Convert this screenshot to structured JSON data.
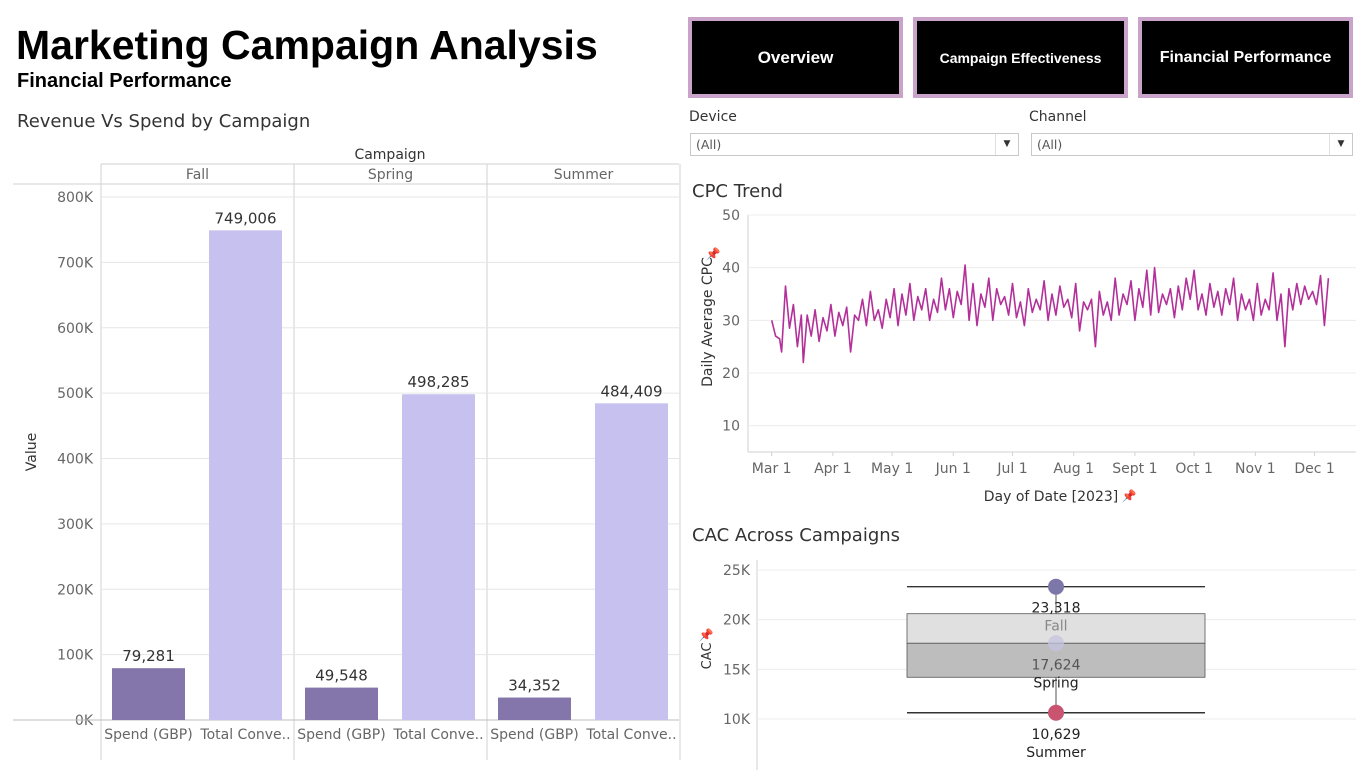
{
  "header": {
    "title": "Marketing Campaign Analysis",
    "subtitle": "Financial Performance"
  },
  "nav": [
    {
      "label": "Overview"
    },
    {
      "label": "Campaign Effectiveness"
    },
    {
      "label": "Financial Performance"
    }
  ],
  "filters": {
    "device": {
      "label": "Device",
      "value": "(All)"
    },
    "channel": {
      "label": "Channel",
      "value": "(All)"
    }
  },
  "colors": {
    "spend": "#8475aa",
    "conversions": "#c7c1ef",
    "cpc_line": "#b3309a",
    "nav_bg": "#000000",
    "nav_border": "#c9a3c9"
  },
  "chart_data": [
    {
      "type": "bar",
      "title": "Revenue Vs Spend by Campaign",
      "column_header": "Campaign",
      "ylabel": "Value",
      "ylim": [
        0,
        800000
      ],
      "yticks": [
        "0K",
        "100K",
        "200K",
        "300K",
        "400K",
        "500K",
        "600K",
        "700K",
        "800K"
      ],
      "groups": [
        {
          "name": "Fall",
          "values": [
            {
              "label": "Spend (GBP)",
              "value": 79281,
              "text": "79,281"
            },
            {
              "label": "Total Conve..",
              "value": 749006,
              "text": "749,006"
            }
          ]
        },
        {
          "name": "Spring",
          "values": [
            {
              "label": "Spend (GBP)",
              "value": 49548,
              "text": "49,548"
            },
            {
              "label": "Total Conve..",
              "value": 498285,
              "text": "498,285"
            }
          ]
        },
        {
          "name": "Summer",
          "values": [
            {
              "label": "Spend (GBP)",
              "value": 34352,
              "text": "34,352"
            },
            {
              "label": "Total Conve..",
              "value": 484409,
              "text": "484,409"
            }
          ]
        }
      ]
    },
    {
      "type": "line",
      "title": "CPC Trend",
      "xlabel": "Day of Date [2023]",
      "ylabel": "Daily Average CPC",
      "ylim": [
        5,
        50
      ],
      "yticks": [
        10,
        20,
        30,
        40,
        50
      ],
      "xticks": [
        {
          "date": "2023-03-01",
          "label": "Mar 1"
        },
        {
          "date": "2023-04-01",
          "label": "Apr 1"
        },
        {
          "date": "2023-05-01",
          "label": "May 1"
        },
        {
          "date": "2023-06-01",
          "label": "Jun 1"
        },
        {
          "date": "2023-07-01",
          "label": "Jul 1"
        },
        {
          "date": "2023-08-01",
          "label": "Aug 1"
        },
        {
          "date": "2023-09-01",
          "label": "Sept 1"
        },
        {
          "date": "2023-10-01",
          "label": "Oct 1"
        },
        {
          "date": "2023-11-01",
          "label": "Nov 1"
        },
        {
          "date": "2023-12-01",
          "label": "Dec 1"
        }
      ],
      "xlim": [
        "2023-02-17",
        "2023-12-22"
      ],
      "series": [
        {
          "points": [
            [
              "2023-03-01",
              30.0
            ],
            [
              "2023-03-03",
              27.0
            ],
            [
              "2023-03-05",
              26.5
            ],
            [
              "2023-03-06",
              24.0
            ],
            [
              "2023-03-08",
              36.5
            ],
            [
              "2023-03-10",
              28.5
            ],
            [
              "2023-03-12",
              33.0
            ],
            [
              "2023-03-14",
              25.0
            ],
            [
              "2023-03-16",
              31.0
            ],
            [
              "2023-03-17",
              22.0
            ],
            [
              "2023-03-19",
              31.0
            ],
            [
              "2023-03-21",
              27.0
            ],
            [
              "2023-03-23",
              32.0
            ],
            [
              "2023-03-25",
              26.0
            ],
            [
              "2023-03-27",
              30.5
            ],
            [
              "2023-03-29",
              28.0
            ],
            [
              "2023-03-31",
              33.0
            ],
            [
              "2023-04-02",
              27.0
            ],
            [
              "2023-04-04",
              31.5
            ],
            [
              "2023-04-06",
              29.0
            ],
            [
              "2023-04-08",
              32.5
            ],
            [
              "2023-04-10",
              24.0
            ],
            [
              "2023-04-12",
              31.0
            ],
            [
              "2023-04-14",
              30.0
            ],
            [
              "2023-04-16",
              34.0
            ],
            [
              "2023-04-18",
              29.0
            ],
            [
              "2023-04-20",
              35.5
            ],
            [
              "2023-04-22",
              30.0
            ],
            [
              "2023-04-24",
              32.0
            ],
            [
              "2023-04-26",
              28.5
            ],
            [
              "2023-04-28",
              34.0
            ],
            [
              "2023-04-30",
              30.5
            ],
            [
              "2023-05-02",
              36.0
            ],
            [
              "2023-05-04",
              29.0
            ],
            [
              "2023-05-06",
              35.0
            ],
            [
              "2023-05-08",
              31.0
            ],
            [
              "2023-05-10",
              37.0
            ],
            [
              "2023-05-12",
              30.0
            ],
            [
              "2023-05-14",
              34.5
            ],
            [
              "2023-05-16",
              32.0
            ],
            [
              "2023-05-18",
              36.0
            ],
            [
              "2023-05-20",
              30.0
            ],
            [
              "2023-05-22",
              34.0
            ],
            [
              "2023-05-24",
              31.5
            ],
            [
              "2023-05-26",
              38.0
            ],
            [
              "2023-05-28",
              32.0
            ],
            [
              "2023-05-30",
              36.0
            ],
            [
              "2023-06-01",
              30.5
            ],
            [
              "2023-06-03",
              35.5
            ],
            [
              "2023-06-05",
              33.0
            ],
            [
              "2023-06-07",
              40.5
            ],
            [
              "2023-06-09",
              30.0
            ],
            [
              "2023-06-11",
              37.0
            ],
            [
              "2023-06-13",
              29.0
            ],
            [
              "2023-06-15",
              35.0
            ],
            [
              "2023-06-17",
              32.5
            ],
            [
              "2023-06-19",
              38.0
            ],
            [
              "2023-06-21",
              30.0
            ],
            [
              "2023-06-23",
              36.0
            ],
            [
              "2023-06-25",
              33.0
            ],
            [
              "2023-06-27",
              34.5
            ],
            [
              "2023-06-29",
              31.0
            ],
            [
              "2023-07-01",
              37.0
            ],
            [
              "2023-07-03",
              30.5
            ],
            [
              "2023-07-05",
              33.5
            ],
            [
              "2023-07-07",
              29.0
            ],
            [
              "2023-07-09",
              36.0
            ],
            [
              "2023-07-11",
              31.5
            ],
            [
              "2023-07-13",
              34.0
            ],
            [
              "2023-07-15",
              32.0
            ],
            [
              "2023-07-17",
              37.5
            ],
            [
              "2023-07-19",
              30.0
            ],
            [
              "2023-07-21",
              35.0
            ],
            [
              "2023-07-23",
              31.0
            ],
            [
              "2023-07-25",
              36.5
            ],
            [
              "2023-07-27",
              32.5
            ],
            [
              "2023-07-29",
              34.0
            ],
            [
              "2023-07-31",
              30.5
            ],
            [
              "2023-08-02",
              37.0
            ],
            [
              "2023-08-04",
              28.0
            ],
            [
              "2023-08-06",
              33.5
            ],
            [
              "2023-08-08",
              32.0
            ],
            [
              "2023-08-10",
              34.0
            ],
            [
              "2023-08-12",
              25.0
            ],
            [
              "2023-08-14",
              35.5
            ],
            [
              "2023-08-16",
              31.0
            ],
            [
              "2023-08-18",
              33.5
            ],
            [
              "2023-08-20",
              30.0
            ],
            [
              "2023-08-22",
              38.0
            ],
            [
              "2023-08-24",
              31.0
            ],
            [
              "2023-08-26",
              35.0
            ],
            [
              "2023-08-28",
              33.0
            ],
            [
              "2023-08-30",
              37.5
            ],
            [
              "2023-09-01",
              30.0
            ],
            [
              "2023-09-03",
              36.0
            ],
            [
              "2023-09-05",
              32.5
            ],
            [
              "2023-09-07",
              39.5
            ],
            [
              "2023-09-09",
              31.0
            ],
            [
              "2023-09-11",
              40.0
            ],
            [
              "2023-09-13",
              31.5
            ],
            [
              "2023-09-15",
              35.0
            ],
            [
              "2023-09-17",
              33.0
            ],
            [
              "2023-09-19",
              36.0
            ],
            [
              "2023-09-21",
              30.5
            ],
            [
              "2023-09-23",
              36.5
            ],
            [
              "2023-09-25",
              32.0
            ],
            [
              "2023-09-27",
              38.0
            ],
            [
              "2023-09-29",
              34.0
            ],
            [
              "2023-10-01",
              39.5
            ],
            [
              "2023-10-03",
              32.0
            ],
            [
              "2023-10-05",
              35.0
            ],
            [
              "2023-10-07",
              31.0
            ],
            [
              "2023-10-09",
              37.0
            ],
            [
              "2023-10-11",
              32.5
            ],
            [
              "2023-10-13",
              35.5
            ],
            [
              "2023-10-15",
              31.0
            ],
            [
              "2023-10-17",
              36.0
            ],
            [
              "2023-10-19",
              33.0
            ],
            [
              "2023-10-21",
              38.0
            ],
            [
              "2023-10-23",
              30.0
            ],
            [
              "2023-10-25",
              35.0
            ],
            [
              "2023-10-27",
              32.0
            ],
            [
              "2023-10-29",
              34.0
            ],
            [
              "2023-10-31",
              30.0
            ],
            [
              "2023-11-02",
              37.0
            ],
            [
              "2023-11-04",
              31.0
            ],
            [
              "2023-11-06",
              34.0
            ],
            [
              "2023-11-08",
              32.0
            ],
            [
              "2023-11-10",
              39.0
            ],
            [
              "2023-11-12",
              30.0
            ],
            [
              "2023-11-14",
              35.0
            ],
            [
              "2023-11-16",
              25.0
            ],
            [
              "2023-11-18",
              36.0
            ],
            [
              "2023-11-20",
              32.0
            ],
            [
              "2023-11-22",
              37.0
            ],
            [
              "2023-11-24",
              33.0
            ],
            [
              "2023-11-26",
              36.5
            ],
            [
              "2023-11-28",
              34.0
            ],
            [
              "2023-11-30",
              35.5
            ],
            [
              "2023-12-02",
              33.0
            ],
            [
              "2023-12-04",
              38.5
            ],
            [
              "2023-12-06",
              29.0
            ],
            [
              "2023-12-08",
              38.0
            ]
          ]
        }
      ]
    },
    {
      "type": "box",
      "title": "CAC Across Campaigns",
      "ylabel": "CAC",
      "ylim": [
        8000,
        26000
      ],
      "yticks": [
        {
          "value": 10000,
          "label": "10K"
        },
        {
          "value": 15000,
          "label": "15K"
        },
        {
          "value": 20000,
          "label": "20K"
        },
        {
          "value": 25000,
          "label": "25K"
        }
      ],
      "points": [
        {
          "campaign": "Fall",
          "value": 23318,
          "text": "23,318",
          "color": "#7c77a8"
        },
        {
          "campaign": "Spring",
          "value": 17624,
          "text": "17,624",
          "color": "#c5c3de"
        },
        {
          "campaign": "Summer",
          "value": 10629,
          "text": "10,629",
          "color": "#c9546f"
        }
      ],
      "box": {
        "q1": 14200,
        "median": 17624,
        "q3": 20600,
        "whisker_low": 10629,
        "whisker_high": 23318
      }
    }
  ]
}
